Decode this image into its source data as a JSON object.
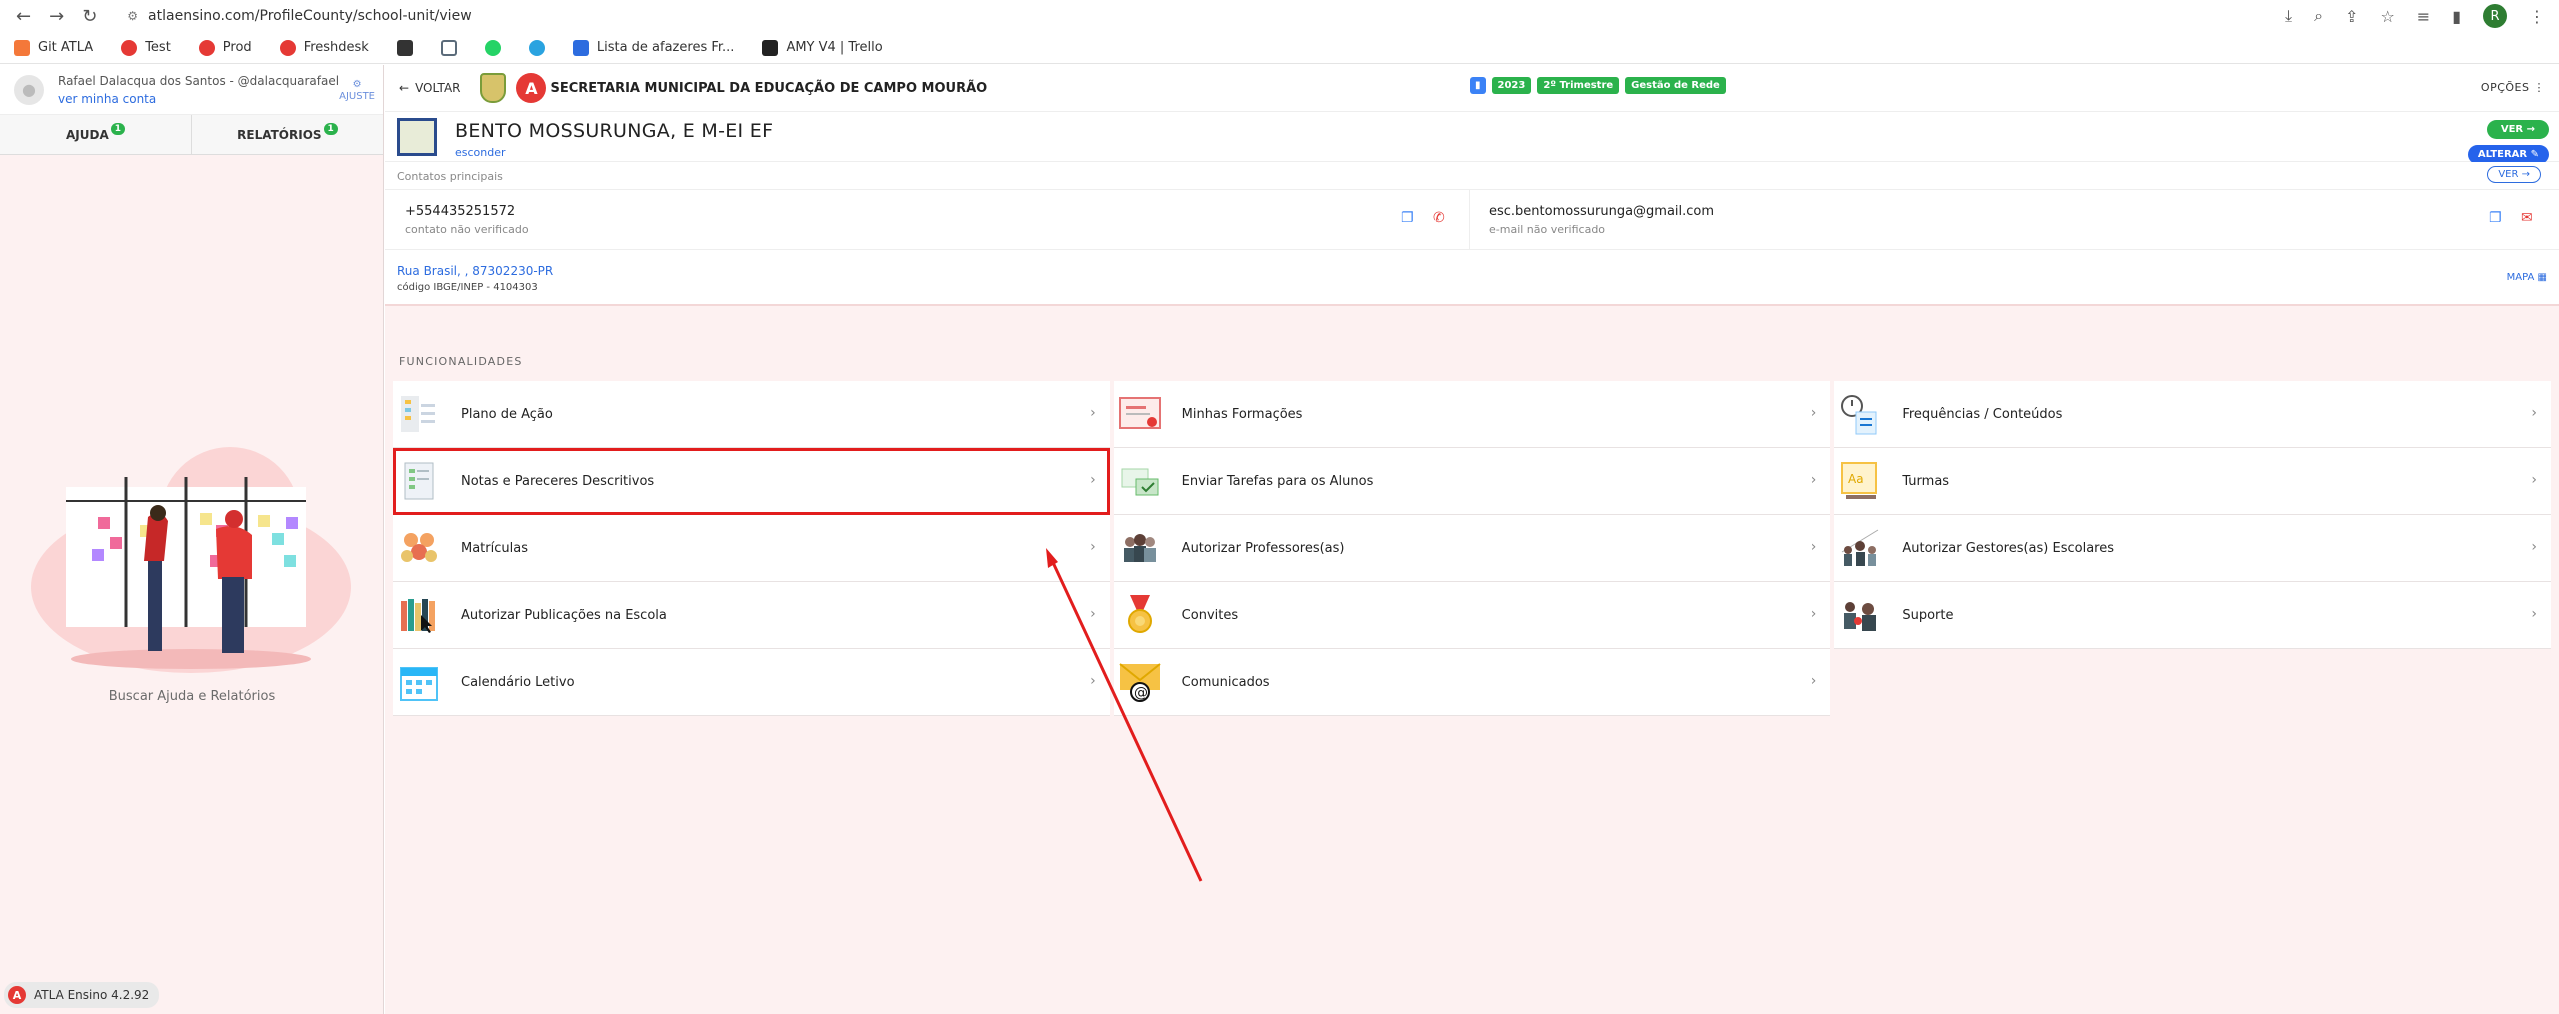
{
  "browser": {
    "url": "atlaensino.com/ProfileCounty/school-unit/view",
    "profile_initial": "R",
    "bookmarks": [
      "Git ATLA",
      "Test",
      "Prod",
      "Freshdesk",
      "Lista de afazeres Fr...",
      "AMY V4 | Trello"
    ]
  },
  "sidebar": {
    "user_name": "Rafael Dalacqua dos Santos - @dalacquarafael",
    "account_link": "ver minha conta",
    "ajuste": "AJUSTE",
    "tabs": [
      {
        "label": "AJUDA",
        "badge": "1"
      },
      {
        "label": "RELATÓRIOS",
        "badge": "1"
      }
    ],
    "help_caption": "Buscar Ajuda e Relatórios",
    "version": "ATLA Ensino 4.2.92"
  },
  "header": {
    "back": "VOLTAR",
    "org": "SECRETARIA MUNICIPAL DA EDUCAÇÃO DE CAMPO MOURÃO",
    "pills": [
      "2023",
      "2º Trimestre",
      "Gestão de Rede"
    ],
    "options": "OPÇÕES"
  },
  "school": {
    "name": "BENTO MOSSURUNGA, E M-EI EF",
    "hide": "esconder",
    "view_btn": "VER",
    "edit_btn": "ALTERAR"
  },
  "contacts": {
    "heading": "Contatos principais",
    "view_btn": "VER",
    "phone": "+554435251572",
    "phone_status": "contato não verificado",
    "email": "esc.bentomossurunga@gmail.com",
    "email_status": "e-mail não verificado",
    "address": "Rua Brasil, , 87302230-PR",
    "ibge": "código IBGE/INEP - 4104303",
    "map": "MAPA"
  },
  "features": {
    "heading": "FUNCIONALIDADES",
    "rows": [
      [
        "Plano de Ação",
        "Minhas Formações",
        "Frequências / Conteúdos"
      ],
      [
        "Notas e Pareceres Descritivos",
        "Enviar Tarefas para os Alunos",
        "Turmas"
      ],
      [
        "Matrículas",
        "Autorizar Professores(as)",
        "Autorizar Gestores(as) Escolares"
      ],
      [
        "Autorizar Publicações na Escola",
        "Convites",
        "Suporte"
      ],
      [
        "Calendário Letivo",
        "Comunicados",
        ""
      ]
    ],
    "highlighted": "Notas e Pareceres Descritivos"
  },
  "colors": {
    "accent_green": "#2bb24c",
    "accent_blue": "#2563eb",
    "highlight_red": "#e21d1d"
  }
}
